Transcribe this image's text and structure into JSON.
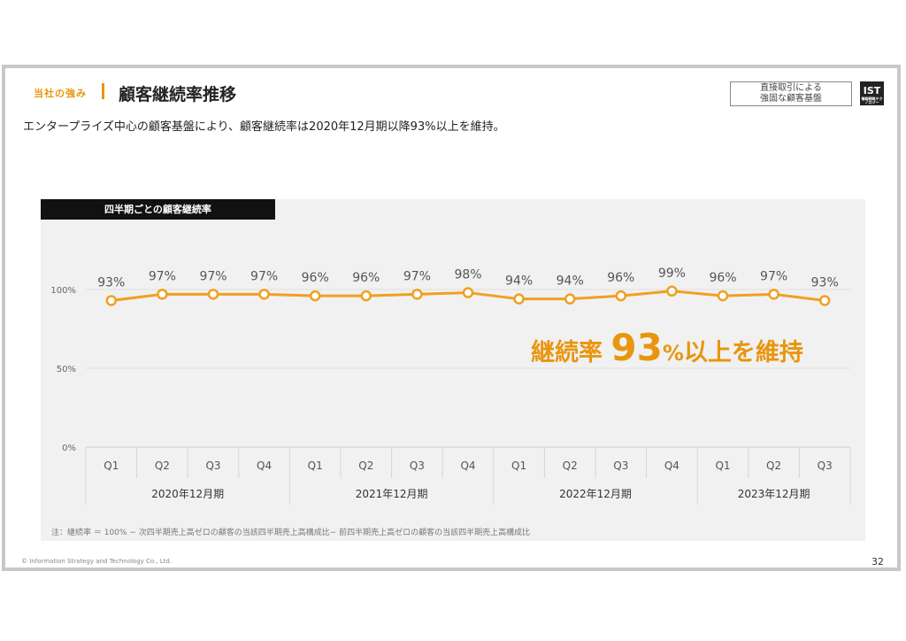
{
  "header": {
    "section_label": "当社の強み",
    "title": "顧客継続率推移",
    "subtitle": "エンタープライズ中心の顧客基盤により、顧客継続率は2020年12月期以降93%以上を維持。",
    "tag_line1": "直接取引による",
    "tag_line2": "強固な顧客基盤",
    "logo_text": "IST",
    "logo_sub": "情報戦略テクノロジー"
  },
  "chart_data": {
    "type": "line",
    "title": "四半期ごとの顧客継続率",
    "quarters": [
      "Q1",
      "Q2",
      "Q3",
      "Q4",
      "Q1",
      "Q2",
      "Q3",
      "Q4",
      "Q1",
      "Q2",
      "Q3",
      "Q4",
      "Q1",
      "Q2",
      "Q3"
    ],
    "groups": [
      {
        "name": "2020年12月期",
        "count": 4
      },
      {
        "name": "2021年12月期",
        "count": 4
      },
      {
        "name": "2022年12月期",
        "count": 4
      },
      {
        "name": "2023年12月期",
        "count": 3
      }
    ],
    "values": [
      93,
      97,
      97,
      97,
      96,
      96,
      97,
      98,
      94,
      94,
      96,
      99,
      96,
      97,
      93
    ],
    "data_labels": [
      "93%",
      "97%",
      "97%",
      "97%",
      "96%",
      "96%",
      "97%",
      "98%",
      "94%",
      "94%",
      "96%",
      "99%",
      "96%",
      "97%",
      "93%"
    ],
    "y_ticks": [
      {
        "value": 0,
        "label": "0%"
      },
      {
        "value": 50,
        "label": "50%"
      },
      {
        "value": 100,
        "label": "100%"
      }
    ],
    "ylim": [
      0,
      100
    ],
    "color": "#f0a020",
    "grid": true
  },
  "callout": {
    "prefix": "継続率 ",
    "number": "93",
    "pct": "%",
    "suffix": "以上を維持"
  },
  "footnote": "注：継続率 ＝ 100% − 次四半期売上高ゼロの顧客の当該四半期売上高構成比− 前四半期売上高ゼロの顧客の当該四半期売上高構成比",
  "copyright": "© Information Strategy and Technology Co., Ltd.",
  "page_number": "32"
}
